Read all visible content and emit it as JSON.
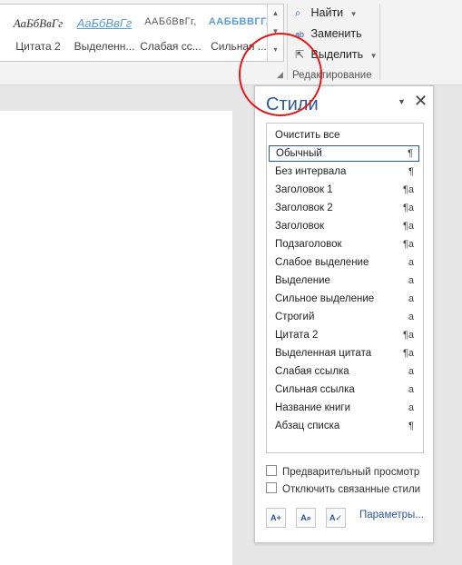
{
  "gallery": {
    "tiles": [
      {
        "sample": "АаБбВвГг",
        "label": "Цитата 2"
      },
      {
        "sample": "АаБбВвГг",
        "label": "Выделенн..."
      },
      {
        "sample": "ААБбВвГг,",
        "label": "Слабая сс..."
      },
      {
        "sample": "ААББВВГГ,",
        "label": "Сильная ..."
      }
    ]
  },
  "editing": {
    "find": "Найти",
    "replace": "Заменить",
    "select": "Выделить",
    "group_label": "Редактирование"
  },
  "pane": {
    "title": "Стили",
    "styles": [
      {
        "name": "Очистить все",
        "symbol": ""
      },
      {
        "name": "Обычный",
        "symbol": "¶"
      },
      {
        "name": "Без интервала",
        "symbol": "¶"
      },
      {
        "name": "Заголовок 1",
        "symbol": "¶a"
      },
      {
        "name": "Заголовок 2",
        "symbol": "¶a"
      },
      {
        "name": "Заголовок",
        "symbol": "¶a"
      },
      {
        "name": "Подзаголовок",
        "symbol": "¶a"
      },
      {
        "name": "Слабое выделение",
        "symbol": "a"
      },
      {
        "name": "Выделение",
        "symbol": "a"
      },
      {
        "name": "Сильное выделение",
        "symbol": "a"
      },
      {
        "name": "Строгий",
        "symbol": "a"
      },
      {
        "name": "Цитата 2",
        "symbol": "¶a"
      },
      {
        "name": "Выделенная цитата",
        "symbol": "¶a"
      },
      {
        "name": "Слабая ссылка",
        "symbol": "a"
      },
      {
        "name": "Сильная ссылка",
        "symbol": "a"
      },
      {
        "name": "Название книги",
        "symbol": "a"
      },
      {
        "name": "Абзац списка",
        "symbol": "¶"
      }
    ],
    "selected_index": 1,
    "preview_label": "Предварительный просмотр",
    "disable_linked_label": "Отключить связанные стили",
    "params_label": "Параметры..."
  },
  "colors": {
    "accent": "#2b579a",
    "annotation": "#e3161a"
  }
}
